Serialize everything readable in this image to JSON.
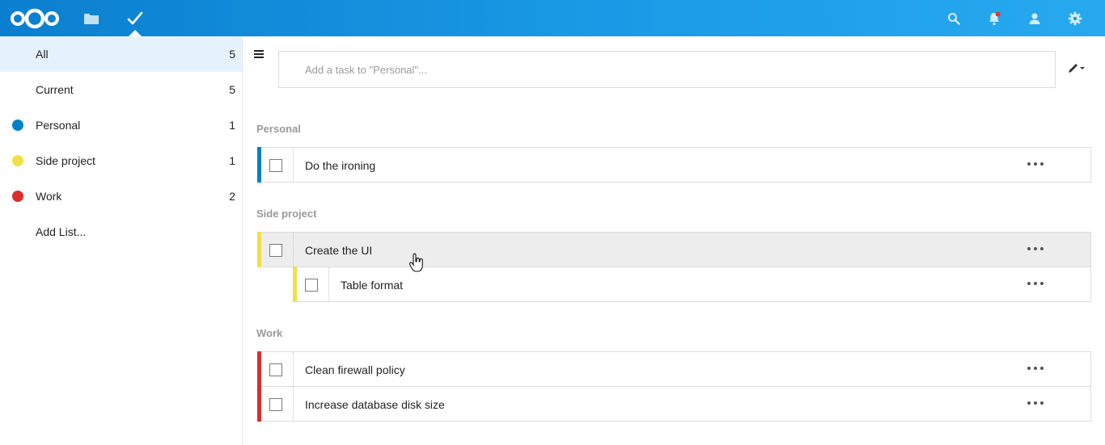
{
  "header": {
    "logo_icon": "nextcloud-logo",
    "nav": [
      {
        "name": "files-icon"
      },
      {
        "name": "tasks-check-icon"
      }
    ],
    "right_icons": [
      "search-icon",
      "bell-icon",
      "contacts-icon",
      "gear-icon"
    ],
    "colors": {
      "bar_start": "#0b7fcf",
      "bar_end": "#27a9ef",
      "notification_dot": "#e9322d"
    }
  },
  "sidebar": {
    "items": [
      {
        "label": "All",
        "count": "5",
        "color": null,
        "active": true
      },
      {
        "label": "Current",
        "count": "5",
        "color": null
      },
      {
        "label": "Personal",
        "count": "1",
        "color": "#0082c9"
      },
      {
        "label": "Side project",
        "count": "1",
        "color": "#f2df48"
      },
      {
        "label": "Work",
        "count": "2",
        "color": "#db2e2e"
      },
      {
        "label": "Add List...",
        "count": "",
        "color": null
      }
    ]
  },
  "main": {
    "add_task_placeholder": "Add a task to \"Personal\"...",
    "groups": [
      {
        "title": "Personal",
        "color": "#0082c9",
        "tasks": [
          {
            "label": "Do the ironing"
          }
        ]
      },
      {
        "title": "Side project",
        "color": "#f2df48",
        "tasks": [
          {
            "label": "Create the UI",
            "hovered": true
          },
          {
            "label": "Table format",
            "subtask": true
          }
        ]
      },
      {
        "title": "Work",
        "color": "#db2e2e",
        "tasks": [
          {
            "label": "Clean firewall policy"
          },
          {
            "label": "Increase database disk size"
          }
        ]
      }
    ]
  }
}
